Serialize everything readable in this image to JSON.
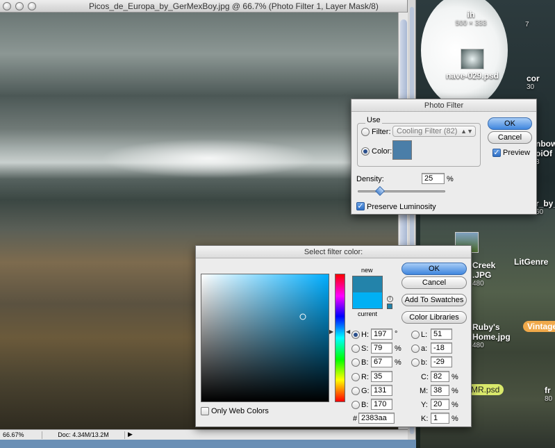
{
  "document": {
    "title": "Picos_de_Europa_by_GerMexBoy.jpg @ 66.7% (Photo Filter 1, Layer Mask/8)",
    "zoom": "66.67%",
    "doc_info": "Doc: 4.34M/13.2M"
  },
  "desktop_icons": [
    {
      "label": "ih",
      "sub": "500 × 333"
    },
    {
      "label": "nave-029.psd",
      "sub": ""
    },
    {
      "label": "cor",
      "sub": "30"
    },
    {
      "label": "nbow",
      "sub": ""
    },
    {
      "label": "oiOf",
      "sub": "3"
    },
    {
      "label": "r_by_",
      "sub": "60"
    },
    {
      "label": "Creek",
      "sub": ""
    },
    {
      "label": ".JPG",
      "sub": "480"
    },
    {
      "label": "LitGenre",
      "sub": ""
    },
    {
      "label": "Ruby's",
      "sub": ""
    },
    {
      "label": "Home.jpg",
      "sub": "480"
    },
    {
      "label": "Vintage",
      "sub": ""
    },
    {
      "label": "MR.psd",
      "sub": ""
    },
    {
      "label": "fr",
      "sub": "80"
    },
    {
      "label": "",
      "sub": "7"
    }
  ],
  "photo_filter": {
    "title": "Photo Filter",
    "use_label": "Use",
    "filter_label": "Filter:",
    "filter_value": "Cooling Filter (82)",
    "color_label": "Color:",
    "color_hex": "#4a7ea8",
    "density_label": "Density:",
    "density_value": "25",
    "density_unit": "%",
    "density_fraction": 0.25,
    "preserve_label": "Preserve Luminosity",
    "preview_label": "Preview",
    "ok_label": "OK",
    "cancel_label": "Cancel"
  },
  "color_picker": {
    "title": "Select filter color:",
    "ok_label": "OK",
    "cancel_label": "Cancel",
    "add_swatches_label": "Add To Swatches",
    "color_libraries_label": "Color Libraries",
    "new_label": "new",
    "current_label": "current",
    "new_color": "#2383aa",
    "current_color": "#00b0f4",
    "hue_color": "#00aeff",
    "only_web_label": "Only Web Colors",
    "hash_label": "#",
    "hex_value": "2383aa",
    "fields": {
      "H": {
        "label": "H:",
        "value": "197",
        "unit": "°"
      },
      "S": {
        "label": "S:",
        "value": "79",
        "unit": "%"
      },
      "B": {
        "label": "B:",
        "value": "67",
        "unit": "%"
      },
      "R": {
        "label": "R:",
        "value": "35",
        "unit": ""
      },
      "G": {
        "label": "G:",
        "value": "131",
        "unit": ""
      },
      "Bb": {
        "label": "B:",
        "value": "170",
        "unit": ""
      },
      "L": {
        "label": "L:",
        "value": "51",
        "unit": ""
      },
      "a": {
        "label": "a:",
        "value": "-18",
        "unit": ""
      },
      "b": {
        "label": "b:",
        "value": "-29",
        "unit": ""
      },
      "C": {
        "label": "C:",
        "value": "82",
        "unit": "%"
      },
      "M": {
        "label": "M:",
        "value": "38",
        "unit": "%"
      },
      "Y": {
        "label": "Y:",
        "value": "20",
        "unit": "%"
      },
      "K": {
        "label": "K:",
        "value": "1",
        "unit": "%"
      }
    },
    "saturation_fraction": 0.79,
    "brightness_fraction": 0.67,
    "hue_fraction": 0.547
  }
}
